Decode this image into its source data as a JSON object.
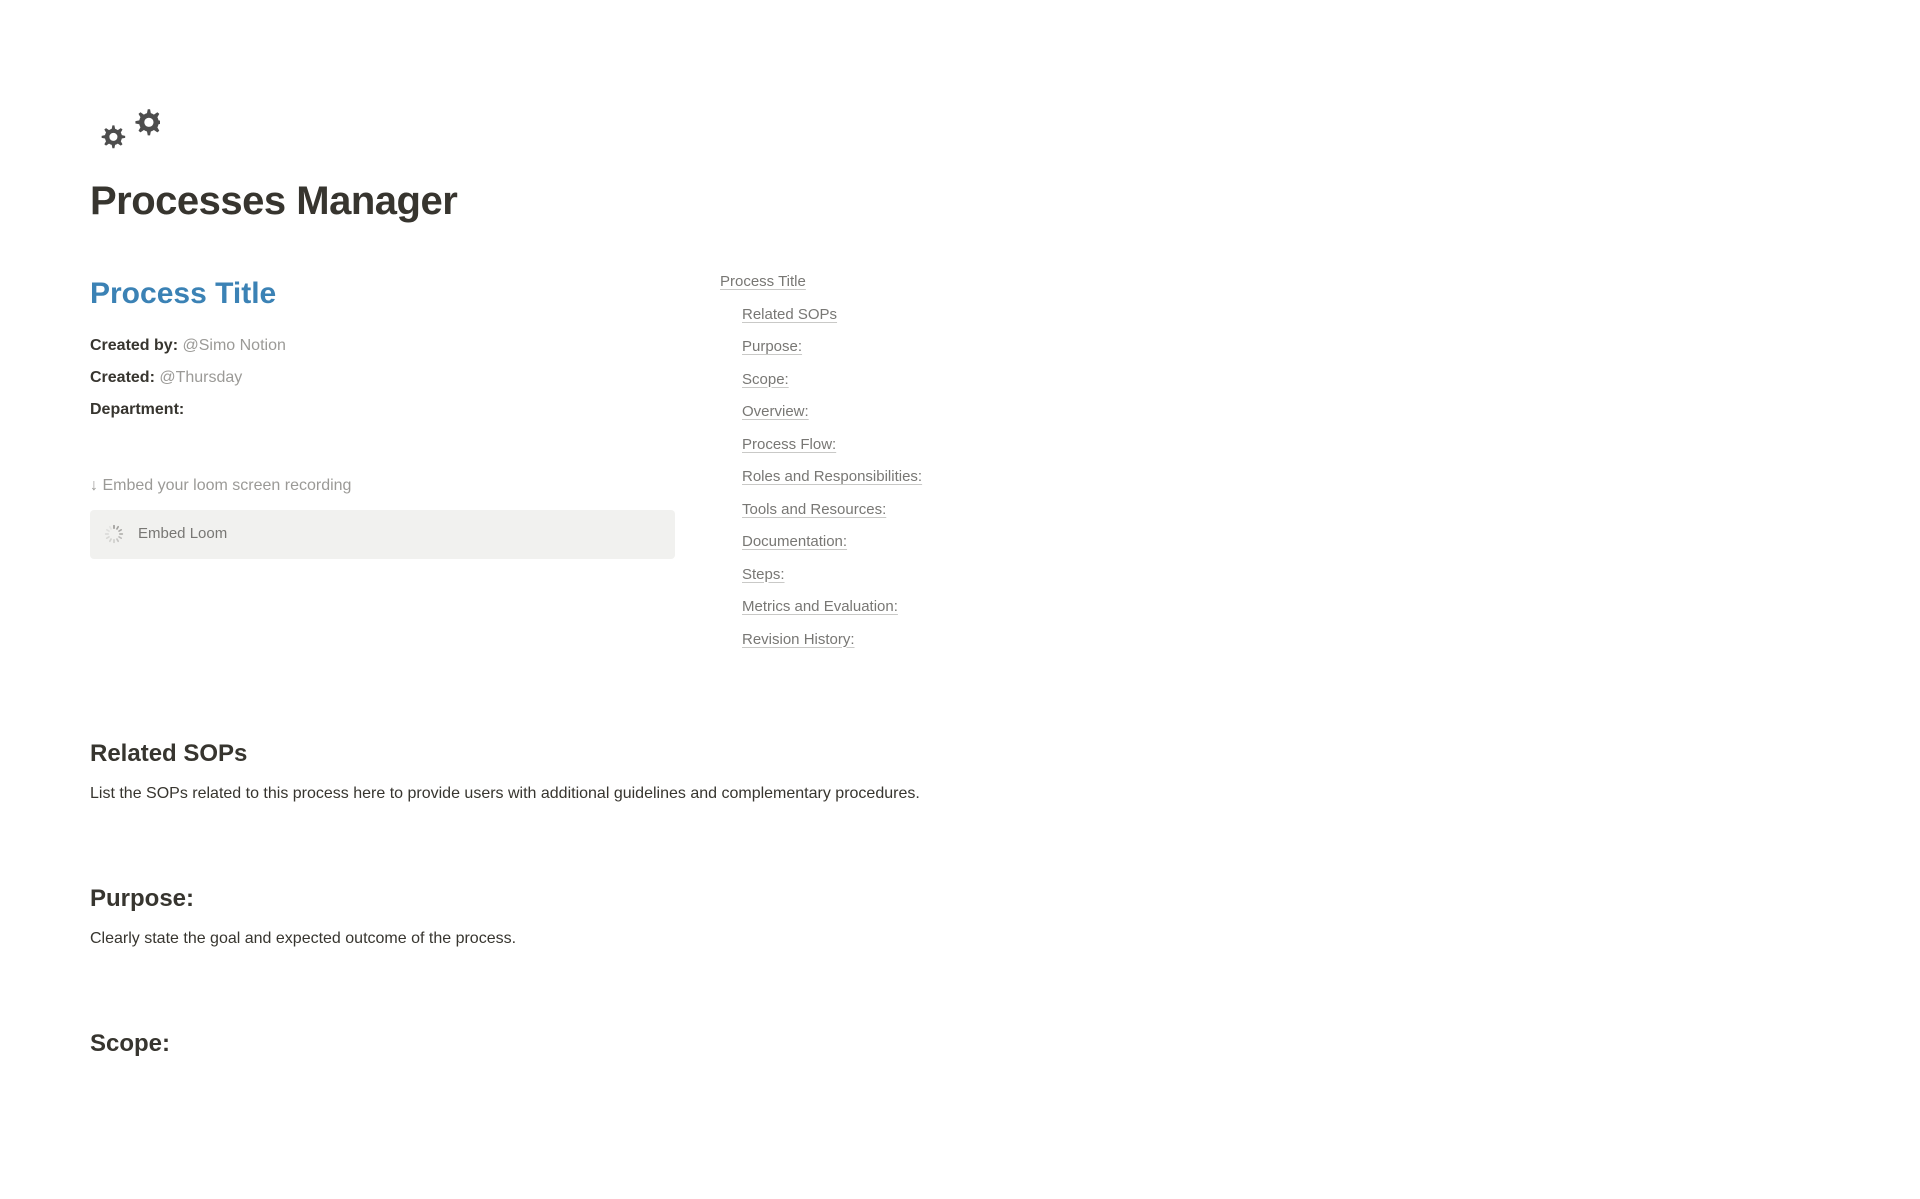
{
  "page": {
    "title": "Processes Manager"
  },
  "process": {
    "title": "Process Title",
    "created_by_label": "Created by:",
    "created_by_value": "@Simo Notion",
    "created_label": "Created:",
    "created_value": "@Thursday",
    "department_label": "Department:"
  },
  "embed": {
    "hint": "↓ Embed your loom screen recording",
    "label": "Embed Loom"
  },
  "toc": {
    "items": [
      {
        "label": "Process Title",
        "level": 0
      },
      {
        "label": "Related SOPs",
        "level": 1
      },
      {
        "label": "Purpose:",
        "level": 1
      },
      {
        "label": "Scope:",
        "level": 1
      },
      {
        "label": "Overview:",
        "level": 1
      },
      {
        "label": "Process Flow:",
        "level": 1
      },
      {
        "label": "Roles and Responsibilities:",
        "level": 1
      },
      {
        "label": "Tools and Resources:",
        "level": 1
      },
      {
        "label": "Documentation:",
        "level": 1
      },
      {
        "label": "Steps:",
        "level": 1
      },
      {
        "label": "Metrics and Evaluation:",
        "level": 1
      },
      {
        "label": "Revision History:",
        "level": 1
      }
    ]
  },
  "sections": {
    "related_sops": {
      "heading": "Related SOPs",
      "body": "List the SOPs related to this process here to provide users with additional guidelines and complementary procedures."
    },
    "purpose": {
      "heading": "Purpose:",
      "body": "Clearly state the goal and expected outcome of the process."
    },
    "scope": {
      "heading": "Scope:",
      "body": ""
    }
  }
}
